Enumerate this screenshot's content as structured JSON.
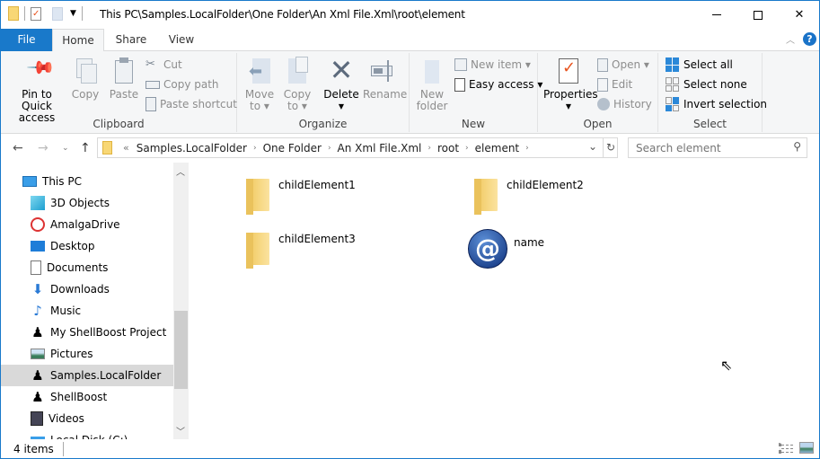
{
  "window": {
    "title": "This PC\\Samples.LocalFolder\\One Folder\\An Xml File.Xml\\root\\element",
    "controls": {
      "minimize": "—",
      "maximize": "☐",
      "close": "✕"
    }
  },
  "tabs": [
    {
      "label": "File"
    },
    {
      "label": "Home"
    },
    {
      "label": "Share"
    },
    {
      "label": "View"
    }
  ],
  "ribbon": {
    "clipboard": {
      "label": "Clipboard",
      "pin": "Pin to Quick access",
      "pin_l1": "Pin to Quick",
      "pin_l2": "access",
      "copy": "Copy",
      "paste": "Paste",
      "cut": "Cut",
      "copy_path": "Copy path",
      "paste_shortcut": "Paste shortcut"
    },
    "organize": {
      "label": "Organize",
      "move_l1": "Move",
      "move_l2": "to ▾",
      "copy_l1": "Copy",
      "copy_l2": "to ▾",
      "delete": "Delete",
      "rename": "Rename"
    },
    "new": {
      "label": "New",
      "new_folder_l1": "New",
      "new_folder_l2": "folder",
      "new_item": "New item ▾",
      "easy_access": "Easy access ▾"
    },
    "open": {
      "label": "Open",
      "properties": "Properties",
      "open": "Open ▾",
      "edit": "Edit",
      "history": "History"
    },
    "select": {
      "label": "Select",
      "select_all": "Select all",
      "select_none": "Select none",
      "invert": "Invert selection"
    }
  },
  "address": {
    "overflow": "«",
    "crumbs": [
      "Samples.LocalFolder",
      "One Folder",
      "An Xml File.Xml",
      "root",
      "element"
    ],
    "search_placeholder": "Search element"
  },
  "nav": {
    "items": [
      {
        "label": "This PC",
        "icon": "pc-icon"
      },
      {
        "label": "3D Objects",
        "icon": "3d-objects-icon"
      },
      {
        "label": "AmalgaDrive",
        "icon": "amalgadrive-icon"
      },
      {
        "label": "Desktop",
        "icon": "desktop-icon"
      },
      {
        "label": "Documents",
        "icon": "documents-icon"
      },
      {
        "label": "Downloads",
        "icon": "downloads-icon"
      },
      {
        "label": "Music",
        "icon": "music-icon"
      },
      {
        "label": "My ShellBoost Project",
        "icon": "shellboost-icon"
      },
      {
        "label": "Pictures",
        "icon": "pictures-icon"
      },
      {
        "label": "Samples.LocalFolder",
        "icon": "shellboost-icon",
        "selected": true
      },
      {
        "label": "ShellBoost",
        "icon": "shellboost-icon"
      },
      {
        "label": "Videos",
        "icon": "videos-icon"
      },
      {
        "label": "Local Disk (C:)",
        "icon": "disk-icon"
      }
    ]
  },
  "content": {
    "items": [
      {
        "name": "childElement1",
        "type": "folder"
      },
      {
        "name": "childElement2",
        "type": "folder"
      },
      {
        "name": "childElement3",
        "type": "folder"
      },
      {
        "name": "name",
        "type": "attribute"
      }
    ]
  },
  "status": {
    "count": "4 items"
  }
}
